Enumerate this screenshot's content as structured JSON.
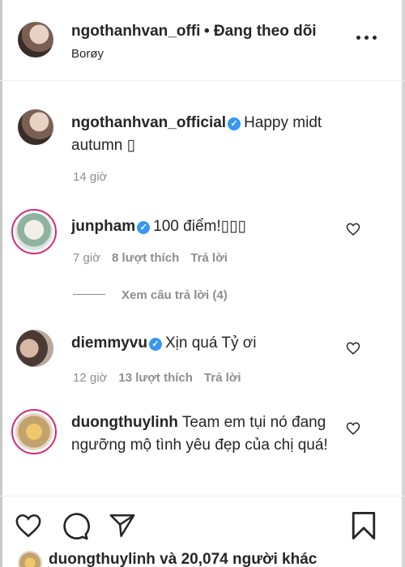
{
  "header": {
    "username": "ngothanhvan_offi",
    "follow_status": "• Đang theo dõi",
    "location": "Borøy",
    "more_icon": "more-horizontal-icon"
  },
  "caption": {
    "username": "ngothanhvan_official",
    "text": "Happy midt autumn ▯",
    "time": "14 giờ"
  },
  "comments": [
    {
      "username": "junpham",
      "verified": true,
      "text": "100 điểm!▯▯▯",
      "time": "7 giờ",
      "likes": "8 lượt thích",
      "reply": "Trả lời",
      "view_replies": "Xem câu trả lời (4)"
    },
    {
      "username": "diemmyvu",
      "verified": true,
      "text": "Xịn quá Tỷ ơi",
      "time": "12 giờ",
      "likes": "13 lượt thích",
      "reply": "Trả lời"
    },
    {
      "username": "duongthuylinh",
      "verified": false,
      "text": "Team em tụi nó đang ngưỡng mộ tình yêu đẹp của chị quá!"
    }
  ],
  "actions": {
    "like_icon": "heart-icon",
    "comment_icon": "comment-icon",
    "share_icon": "paper-plane-icon",
    "save_icon": "bookmark-icon"
  },
  "likes_summary": {
    "username": "duongthuylinh",
    "rest": " và 20,074 người khác"
  },
  "colors": {
    "text": "#262626",
    "secondary": "#8e8e8e",
    "verified": "#3897f0",
    "story_ring": "#d62976"
  }
}
